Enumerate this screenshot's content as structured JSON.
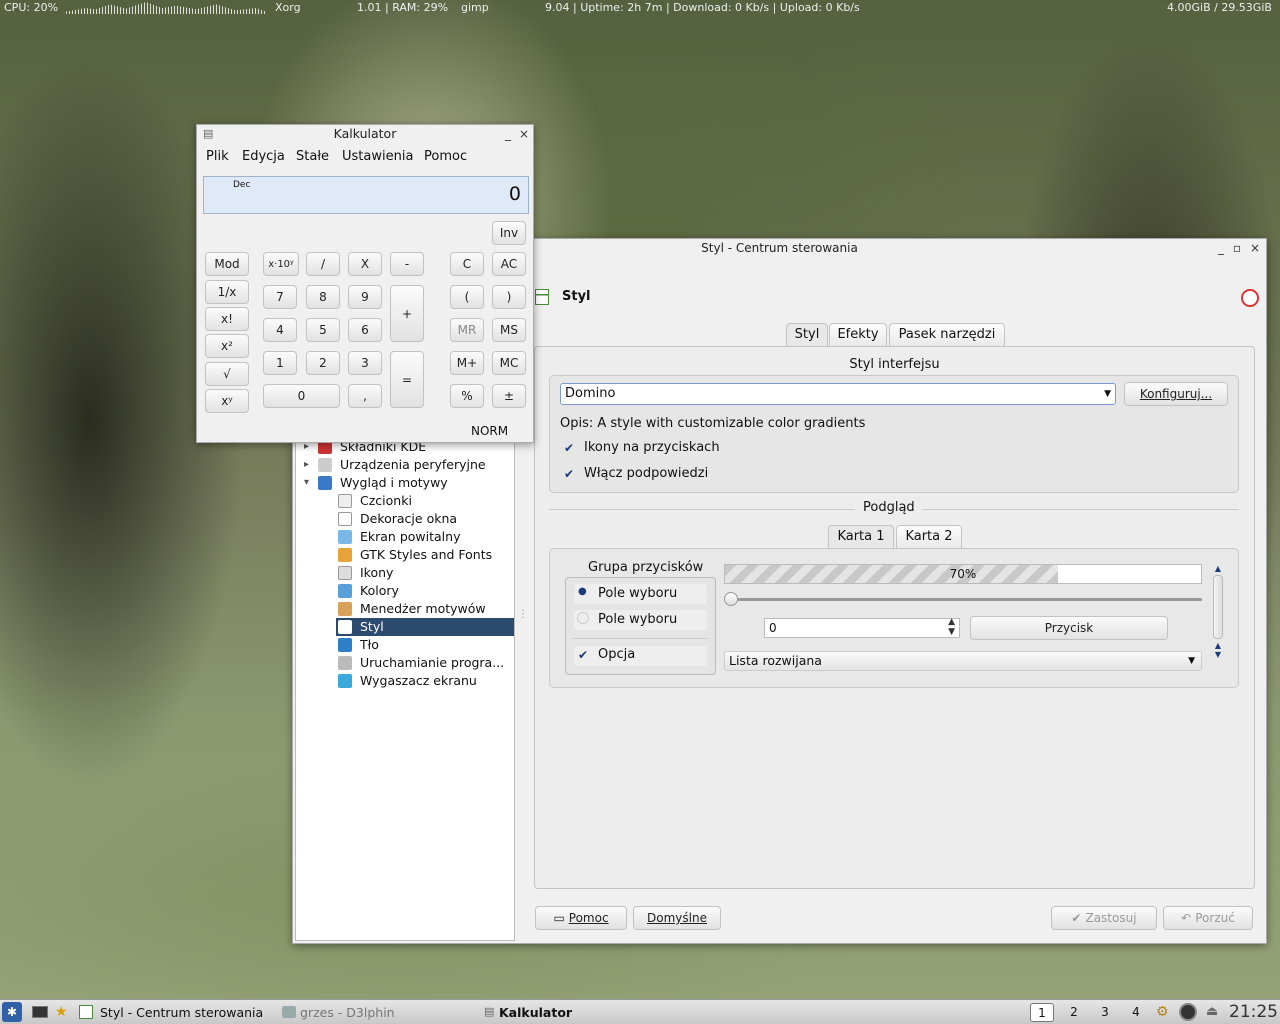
{
  "topbar": {
    "cpu": "CPU: 20%",
    "proc1": "Xorg",
    "load_ram": "1.01 | RAM: 29%",
    "proc2": "gimp",
    "stats": "9.04 | Uptime: 2h 7m | Download: 0 Kb/s | Upload: 0 Kb/s",
    "disk": "4.00GiB / 29.53GiB"
  },
  "calc": {
    "title": "Kalkulator",
    "menu": [
      "Plik",
      "Edycja",
      "Stałe",
      "Ustawienia",
      "Pomoc"
    ],
    "base": "Dec",
    "display": "0",
    "inv": "Inv",
    "status": "NORM",
    "buttons": {
      "mod": "Mod",
      "exp": "x·10ʸ",
      "div": "/",
      "mul": "X",
      "minus": "-",
      "c": "C",
      "ac": "AC",
      "recip": "1/x",
      "n7": "7",
      "n8": "8",
      "n9": "9",
      "plus": "+",
      "lpar": "(",
      "rpar": ")",
      "fact": "x!",
      "n4": "4",
      "n5": "5",
      "n6": "6",
      "mr": "MR",
      "ms": "MS",
      "sq": "x²",
      "n1": "1",
      "n2": "2",
      "n3": "3",
      "eq": "=",
      "mplus": "M+",
      "mc": "MC",
      "sqrt": "√",
      "pow": "xʸ",
      "n0": "0",
      "dot": ",",
      "pct": "%",
      "pm": "±"
    }
  },
  "control": {
    "title": "Styl - Centrum sterowania",
    "module_title": "Styl",
    "tabs": [
      "Styl",
      "Efekty",
      "Pasek narzędzi"
    ],
    "group_title": "Styl interfejsu",
    "style_value": "Domino",
    "configure": "Konfiguruj...",
    "description": "Opis: A style with customizable color gradients",
    "opt1": "Ikony na przyciskach",
    "opt2": "Włącz podpowiedzi",
    "preview_title": "Podgląd",
    "preview_tabs": [
      "Karta 1",
      "Karta 2"
    ],
    "button_group": "Grupa przycisków",
    "radio1": "Pole wyboru",
    "radio2": "Pole wyboru",
    "check": "Opcja",
    "progress_label": "70%",
    "progress": 0.7,
    "spin_value": "0",
    "push": "Przycisk",
    "combo": "Lista rozwijana",
    "footer": {
      "help": "Pomoc",
      "defaults": "Domyślne",
      "apply": "Zastosuj",
      "cancel": "Porzuć"
    },
    "tree": [
      "Składniki KDE",
      "Urządzenia peryferyjne",
      "Wygląd i motywy",
      "Czcionki",
      "Dekoracje okna",
      "Ekran powitalny",
      "GTK Styles and Fonts",
      "Ikony",
      "Kolory",
      "Menedżer motywów",
      "Styl",
      "Tło",
      "Uruchamianie progra...",
      "Wygaszacz ekranu"
    ]
  },
  "taskbar": {
    "task1": "Styl - Centrum sterowania",
    "task2": "grzes - D3lphin",
    "task3": "Kalkulator",
    "ws": [
      "1",
      "2",
      "3",
      "4"
    ],
    "clock": "21:25"
  }
}
